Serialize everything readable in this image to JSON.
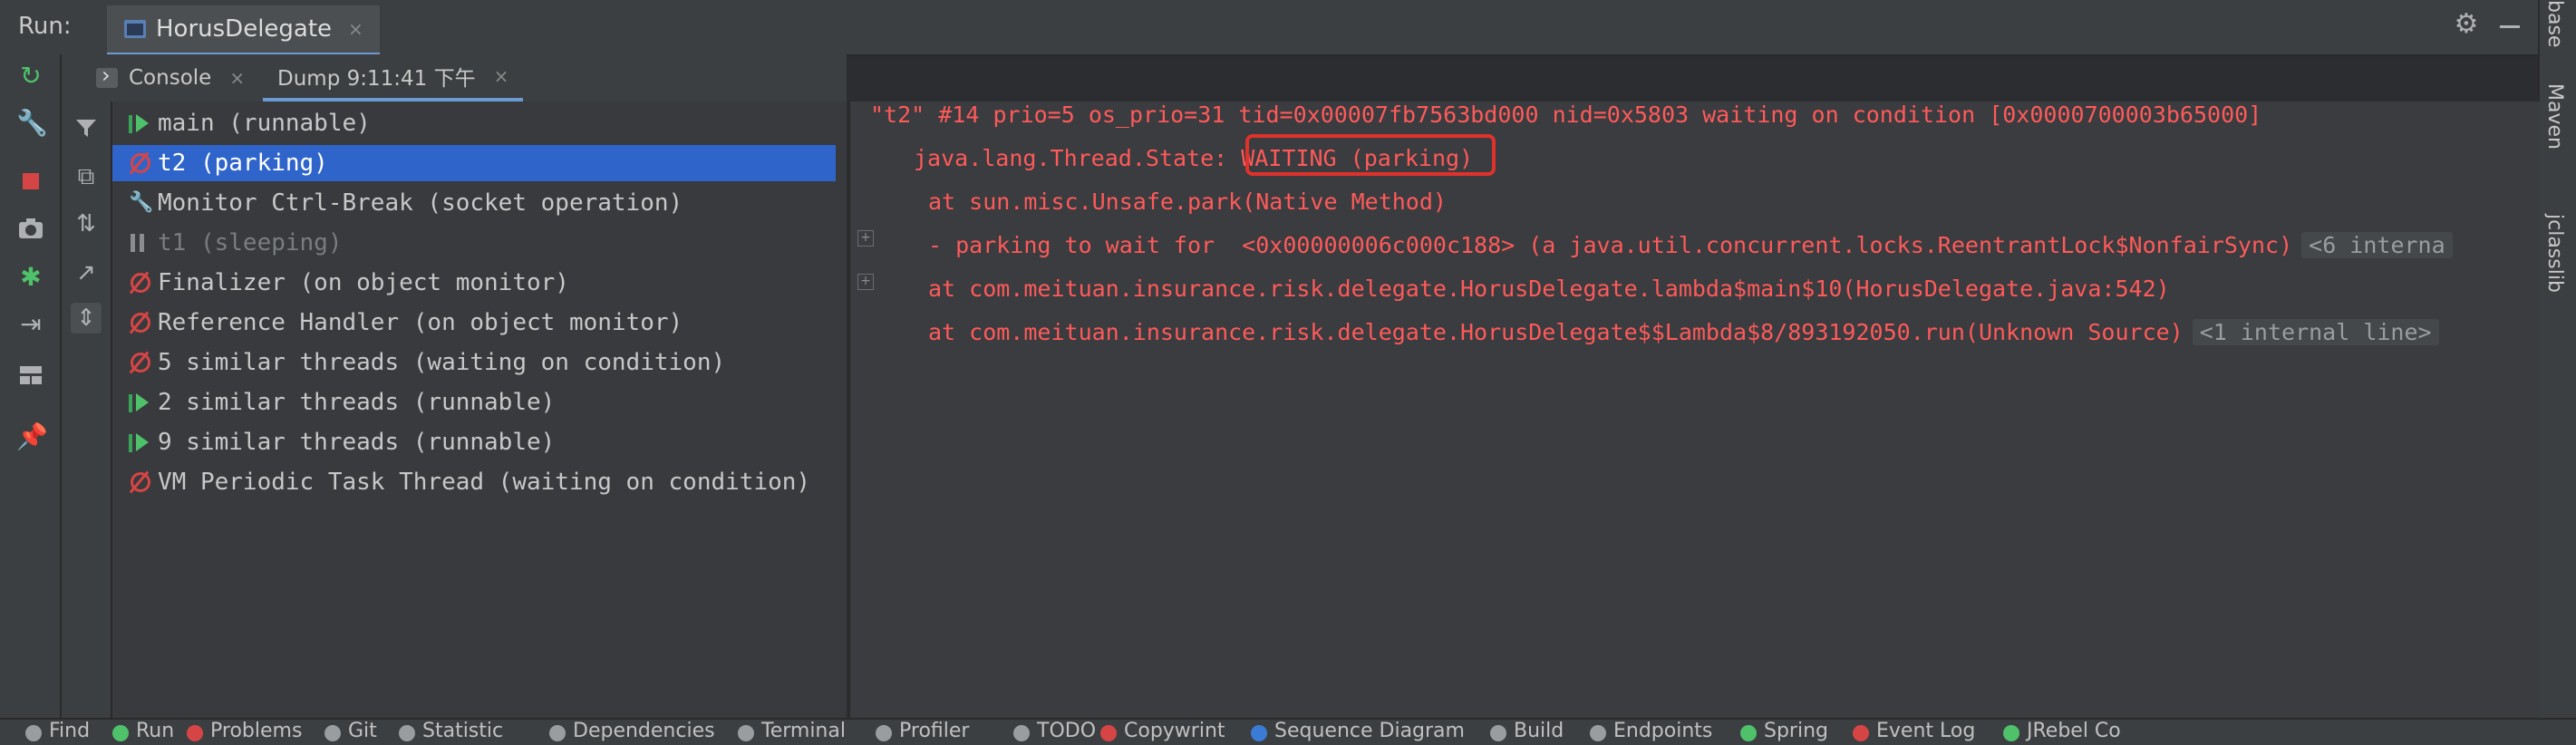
{
  "run_bar": {
    "label": "Run:",
    "tab_title": "HorusDelegate",
    "tab_close": "×",
    "gear_icon": "⚙"
  },
  "right_strip": {
    "items": [
      "base",
      "Maven",
      "jclasslib"
    ]
  },
  "sub_tabs": [
    {
      "label": "Console",
      "close": "×"
    },
    {
      "label": "Dump 9:11:41 下午",
      "close": "×"
    }
  ],
  "threads": [
    {
      "label": "main (runnable)",
      "state": "runnable"
    },
    {
      "label": "t2 (parking)",
      "state": "parking",
      "selected": true
    },
    {
      "label": "Monitor Ctrl-Break (socket operation)",
      "state": "wrench"
    },
    {
      "label": "t1 (sleeping)",
      "state": "sleeping"
    },
    {
      "label": "Finalizer (on object monitor)",
      "state": "parking"
    },
    {
      "label": "Reference Handler (on object monitor)",
      "state": "parking"
    },
    {
      "label": "5 similar threads (waiting on condition)",
      "state": "parking"
    },
    {
      "label": "2 similar threads (runnable)",
      "state": "runnable"
    },
    {
      "label": "9 similar threads (runnable)",
      "state": "runnable"
    },
    {
      "label": "VM Periodic Task Thread (waiting on condition)",
      "state": "parking"
    }
  ],
  "dump": {
    "line1": "\"t2\" #14 prio=5 os_prio=31 tid=0x00007fb7563bd000 nid=0x5803 waiting on condition [0x0000700003b65000]",
    "line2_prefix": "java.lang.Thread.State: ",
    "line2_state": "WAITING (parking)",
    "line3": "at sun.misc.Unsafe.park(Native Method)",
    "line4": "- parking to wait for  <0x00000006c000c188> (a java.util.concurrent.locks.ReentrantLock$NonfairSync)",
    "line4_hint": "<6 interna",
    "line5": "at com.meituan.insurance.risk.delegate.HorusDelegate.lambda$main$10(HorusDelegate.java:542)",
    "line6": "at com.meituan.insurance.risk.delegate.HorusDelegate$$Lambda$8/893192050.run(Unknown Source)",
    "line6_hint": "<1 internal line>"
  },
  "bottom_bar": [
    {
      "label": "Find",
      "color": "#9a9da0"
    },
    {
      "label": "Run",
      "color": "#4fc16a"
    },
    {
      "label": "Problems",
      "color": "#d64545"
    },
    {
      "label": "Git",
      "color": "#9a9da0"
    },
    {
      "label": "Statistic",
      "color": "#9a9da0"
    },
    {
      "label": "Dependencies",
      "color": "#9a9da0"
    },
    {
      "label": "Terminal",
      "color": "#9a9da0"
    },
    {
      "label": "Profiler",
      "color": "#9a9da0"
    },
    {
      "label": "TODO",
      "color": "#9a9da0"
    },
    {
      "label": "Copywrint",
      "color": "#d64545"
    },
    {
      "label": "Sequence Diagram",
      "color": "#3a7bd5"
    },
    {
      "label": "Build",
      "color": "#9a9da0"
    },
    {
      "label": "Endpoints",
      "color": "#9a9da0"
    },
    {
      "label": "Spring",
      "color": "#4fc16a"
    },
    {
      "label": "Event Log",
      "color": "#d64545"
    },
    {
      "label": "JRebel Co",
      "color": "#4fc16a"
    }
  ]
}
